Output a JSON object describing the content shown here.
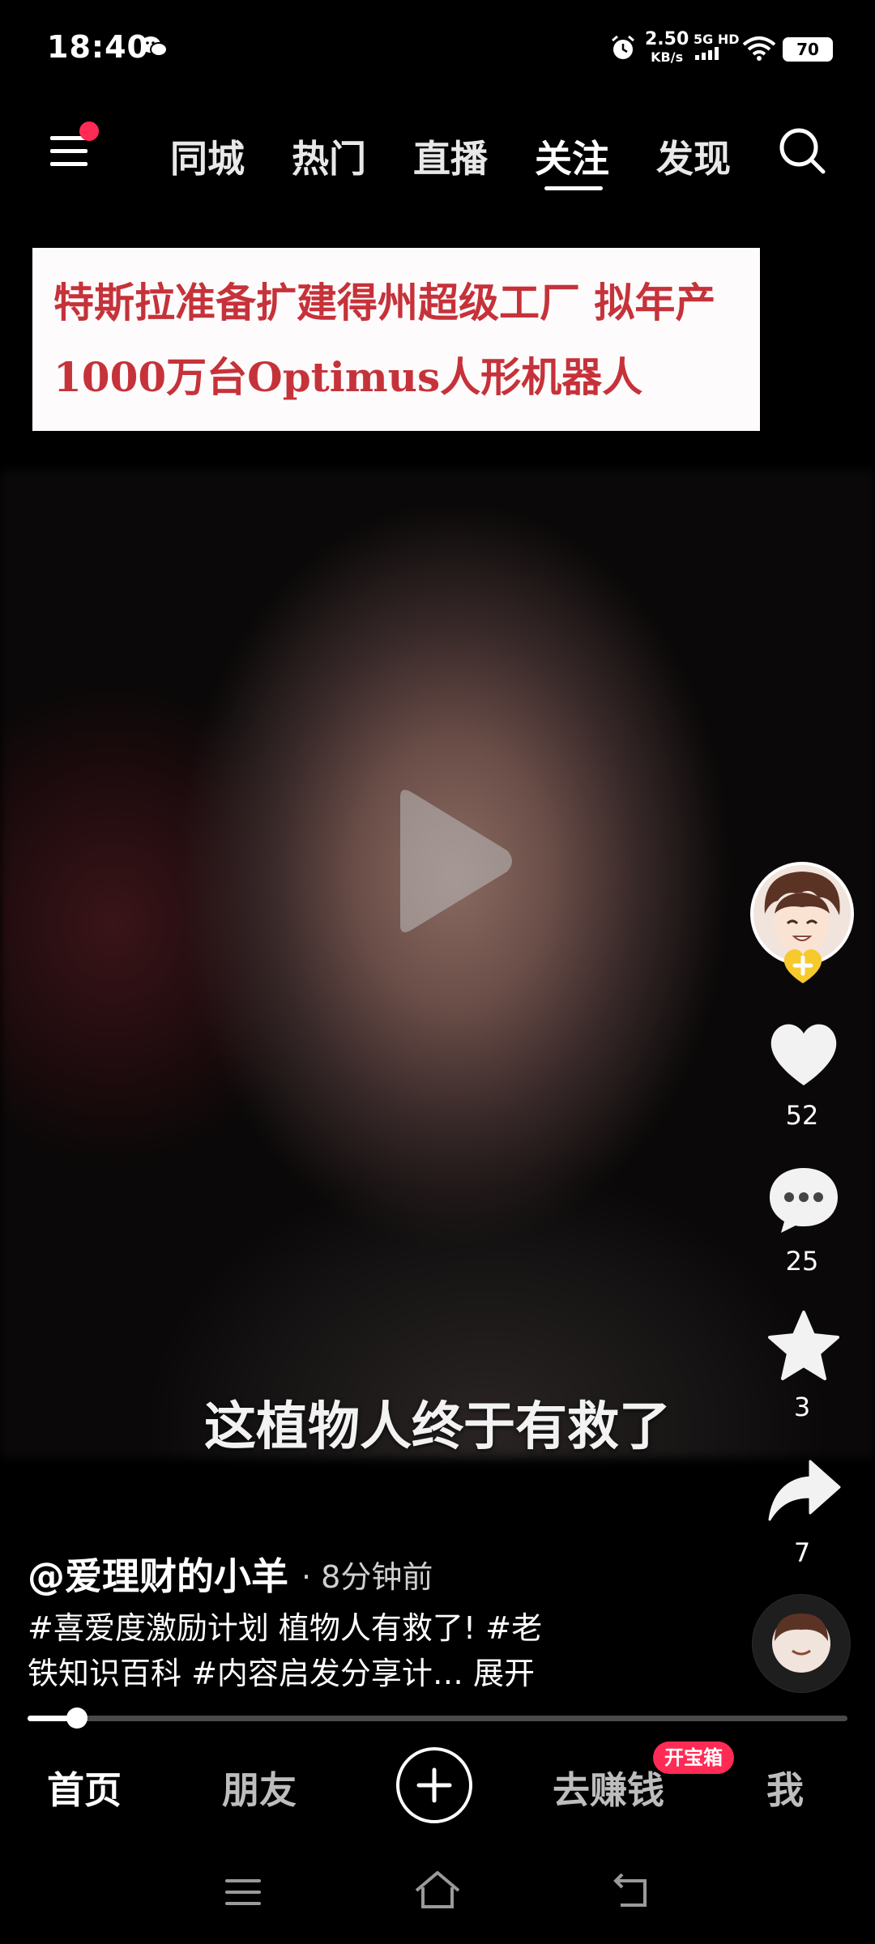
{
  "status_bar": {
    "time": "18:40",
    "speed_value": "2.50",
    "speed_unit": "KB/s",
    "network": "5G HD",
    "battery": "70",
    "icons": [
      "wechat-icon",
      "alarm-icon",
      "signal-icon",
      "wifi-icon",
      "battery-icon"
    ]
  },
  "top_nav": {
    "tabs": [
      {
        "label": "同城",
        "active": false
      },
      {
        "label": "热门",
        "active": false
      },
      {
        "label": "直播",
        "active": false
      },
      {
        "label": "关注",
        "active": true
      },
      {
        "label": "发现",
        "active": false
      }
    ],
    "has_notification_dot": true
  },
  "video": {
    "headline_line1": "特斯拉准备扩建得州超级工厂 拟年产",
    "headline_line2": "1000万台Optimus人形机器人",
    "subtitle": "这植物人终于有救了",
    "paused": true
  },
  "actions": {
    "likes": "52",
    "comments": "25",
    "favorites": "3",
    "shares": "7"
  },
  "post": {
    "author": "@爱理财的小羊",
    "time_ago": "· 8分钟前",
    "description_line1": "#喜爱度激励计划 植物人有救了! #老",
    "description_line2": "铁知识百科 #内容启发分享计…",
    "expand_label": "展开"
  },
  "progress": {
    "fraction": 0.06
  },
  "bottom_nav": {
    "home": "首页",
    "friends": "朋友",
    "earn": "去赚钱",
    "earn_badge": "开宝箱",
    "me": "我"
  },
  "colors": {
    "accent": "#ff2b54",
    "headline_text": "#c6323a",
    "background": "#000000"
  }
}
